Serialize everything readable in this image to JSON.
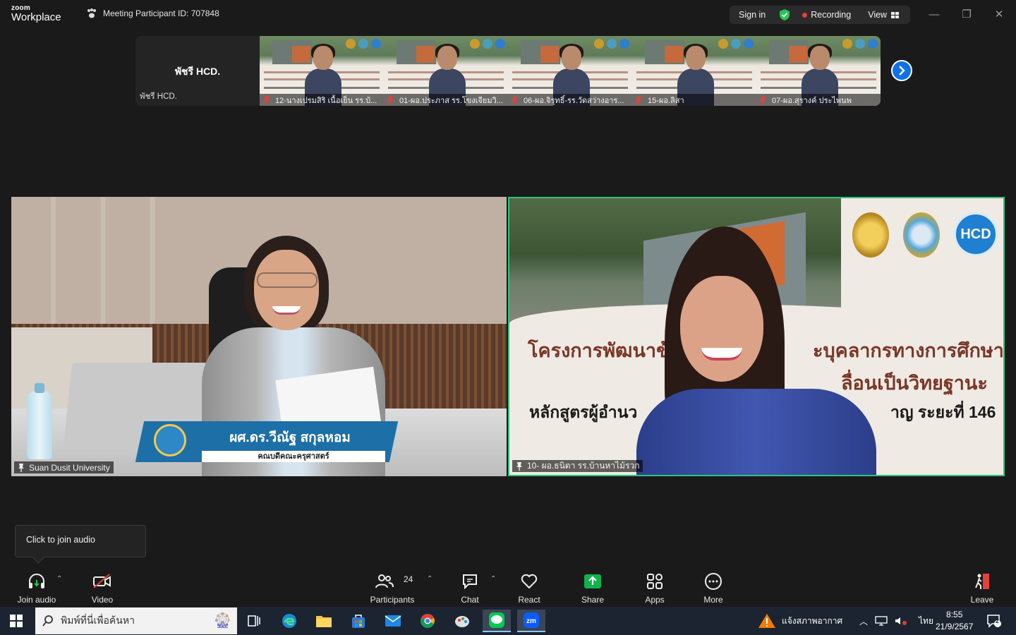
{
  "app": {
    "logo_top": "zoom",
    "logo_bottom": "Workplace",
    "meeting_id": "Meeting Participant ID: 707848",
    "sign_in": "Sign in",
    "recording": "Recording",
    "view": "View"
  },
  "filmstrip": {
    "name_tile_big": "พัชรี HCD.",
    "name_tile_small": "พัชรี HCD.",
    "tiles": [
      {
        "label": "12-นางเปรมสิริ เนื้อเย็น รร.บ้..."
      },
      {
        "label": "01-ผอ.ประภาส รร.โขงเจียมวิ..."
      },
      {
        "label": "06-ผอ.จิรุทธิ์-รร.วัดสว่างอาร..."
      },
      {
        "label": "15-ผอ.ลิสา"
      },
      {
        "label": "07-ผอ.สุรางค์ ประไพนพ"
      }
    ]
  },
  "videos": {
    "left": {
      "label": "Suan Dusit University",
      "nameplate_name": "ผศ.ดร.วีณัฐ สกุลหอม",
      "nameplate_sub": "คณบดีคณะครุศาสตร์"
    },
    "right": {
      "label": "10- ผอ.ธนิตา รร.บ้านหาไม้รวก",
      "bg_line1": "โครงการพัฒนาข้",
      "bg_line1b": "ะบุคลากรทางการศึกษา",
      "bg_line2": "ลื่อนเป็นวิทยฐานะ",
      "bg_line3": "หลักสูตรผู้อำนว",
      "bg_line3b": "าญ ระยะที่ 146",
      "logo_hcd": "HCD"
    }
  },
  "tooltip": {
    "text": "Click to join audio"
  },
  "toolbar": {
    "join_audio": "Join audio",
    "video": "Video",
    "participants": "Participants",
    "participants_count": "24",
    "chat": "Chat",
    "react": "React",
    "share": "Share",
    "apps": "Apps",
    "more": "More",
    "leave": "Leave"
  },
  "taskbar": {
    "search_placeholder": "พิมพ์ที่นี่เพื่อค้นหา",
    "weather": "แจ้งสภาพอากาศ",
    "lang": "ไทย",
    "time": "8:55",
    "date": "21/9/2567",
    "notif_count": "2"
  },
  "colors": {
    "accent_blue": "#0e71eb",
    "share_green": "#12b24a",
    "speaker_border": "#2ec27e",
    "recording_red": "#e5413b",
    "leave_red": "#e5413b"
  }
}
